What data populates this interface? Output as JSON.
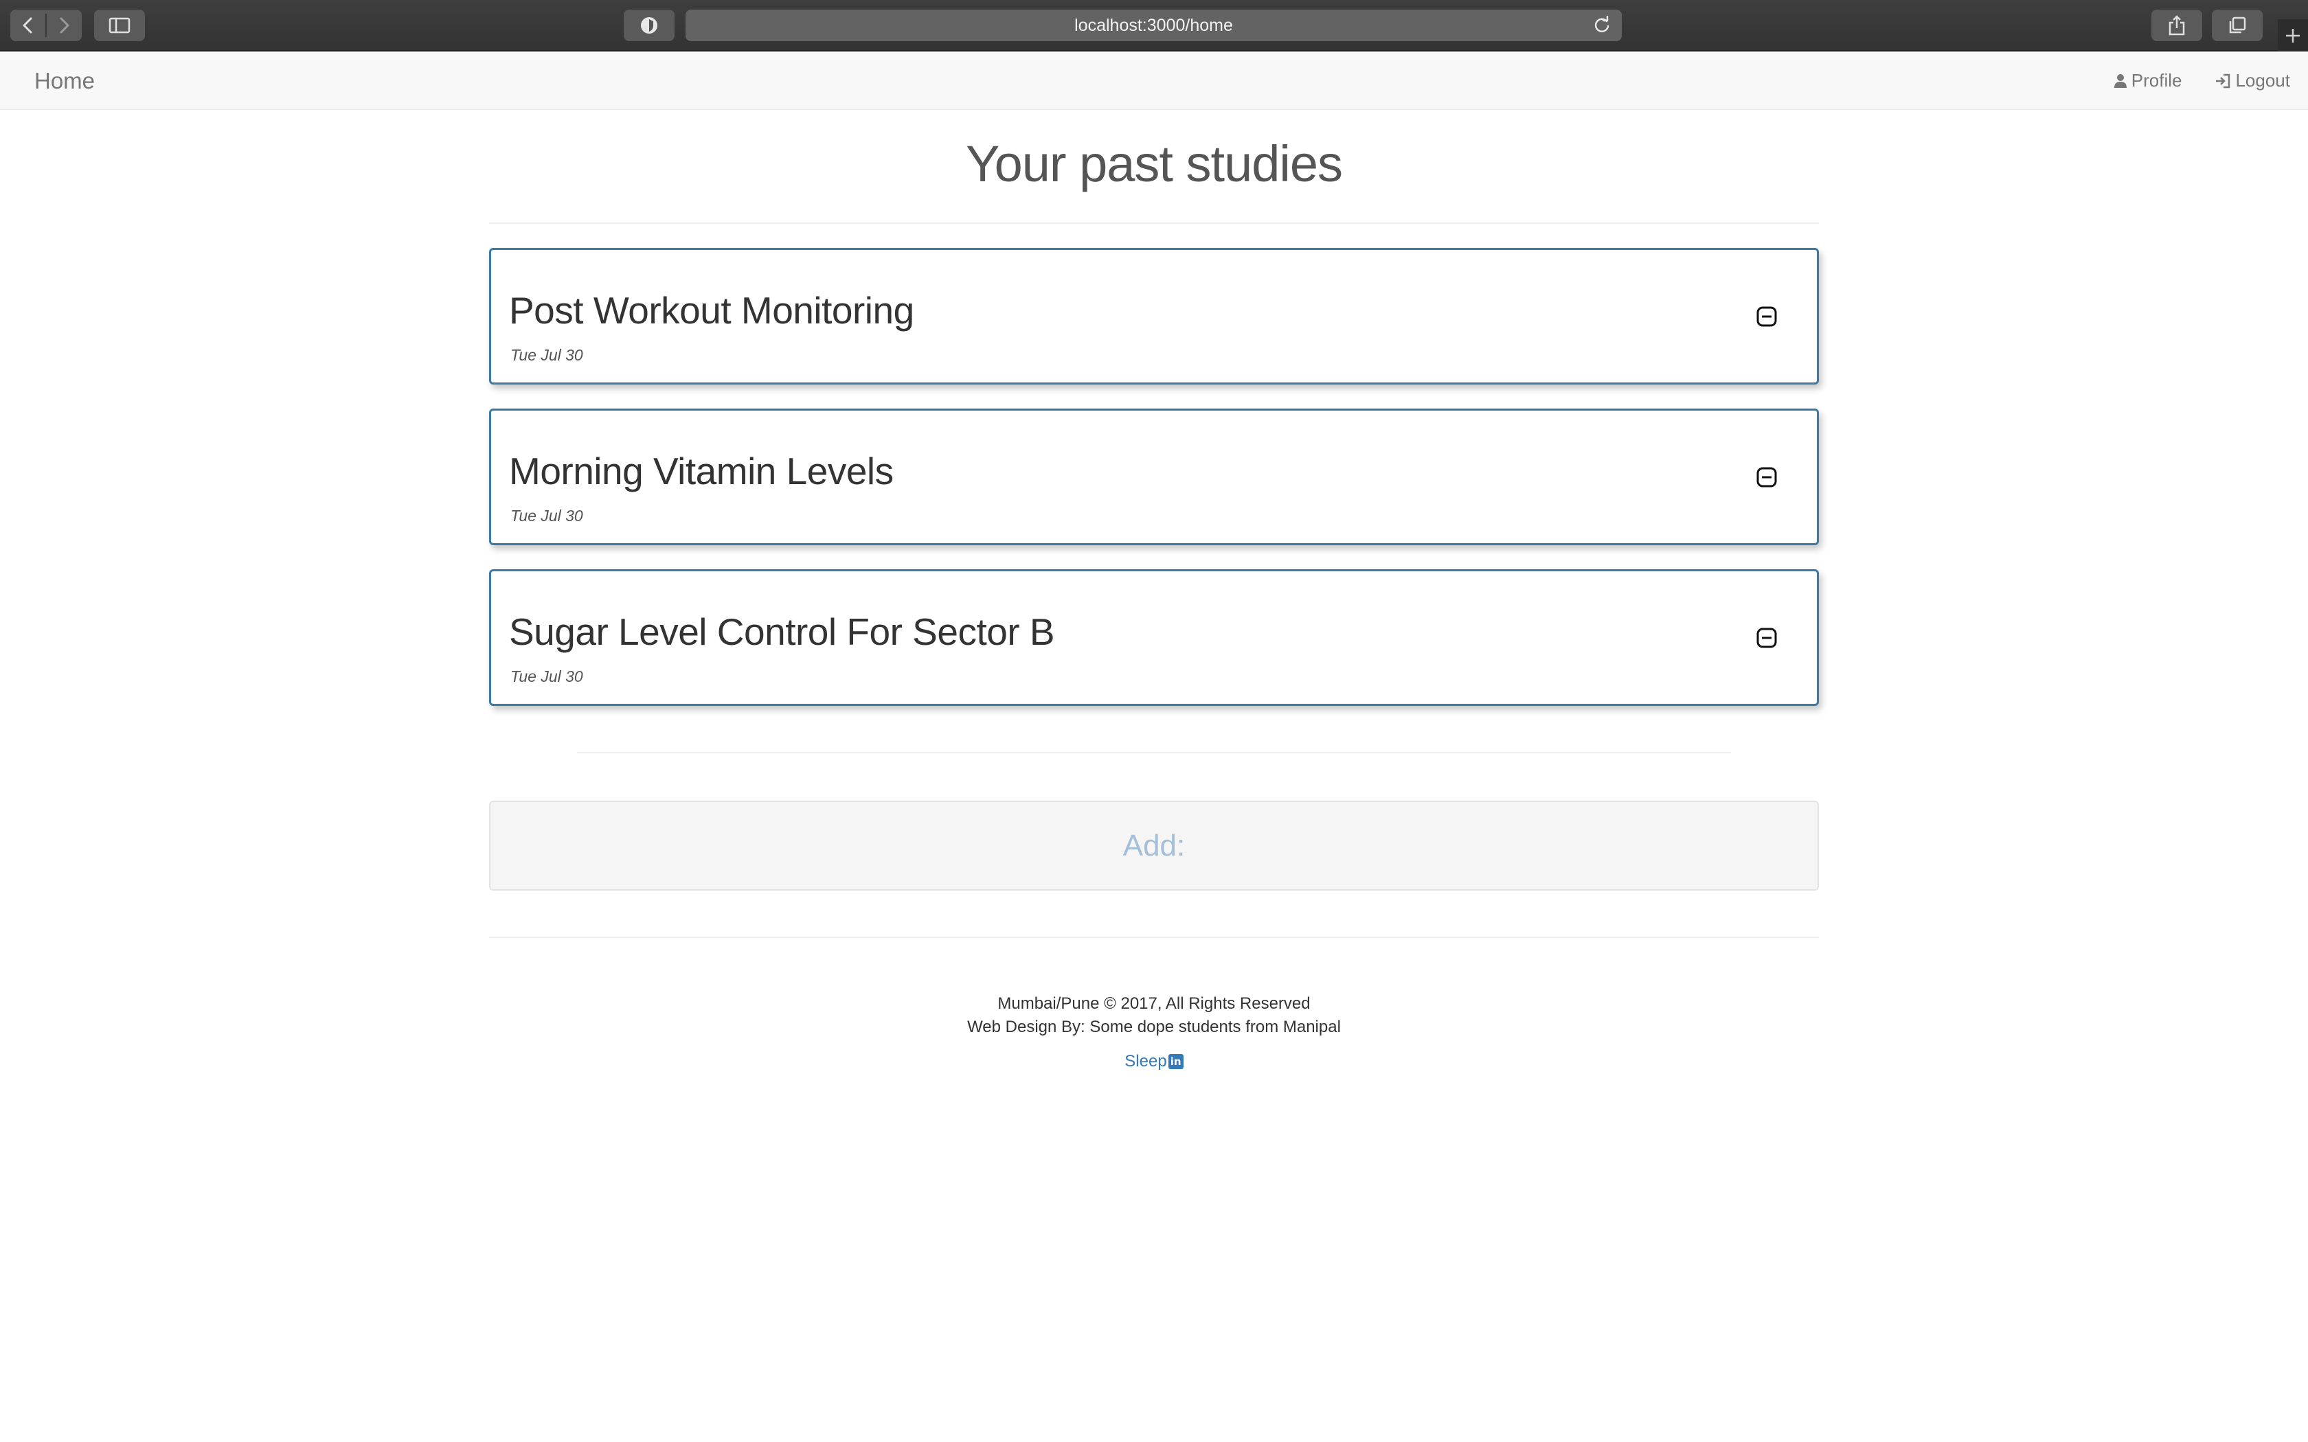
{
  "browser": {
    "url": "localhost:3000/home"
  },
  "navbar": {
    "brand": "Home",
    "profile_label": "Profile",
    "logout_label": "Logout"
  },
  "main": {
    "title": "Your past studies",
    "studies": [
      {
        "name": "Post Workout Monitoring",
        "date": "Tue Jul 30"
      },
      {
        "name": "Morning Vitamin Levels",
        "date": "Tue Jul 30"
      },
      {
        "name": "Sugar Level Control For Sector B",
        "date": "Tue Jul 30"
      }
    ],
    "add_label": "Add:"
  },
  "footer": {
    "copyright": "Mumbai/Pune © 2017, All Rights Reserved",
    "credit": "Web Design By: Some dope students from Manipal",
    "link_label": "Sleep",
    "link_icon": "linkedin-icon"
  },
  "colors": {
    "card_border": "#3c7aa6",
    "link": "#337ab7",
    "add_text": "#a4bfd8"
  }
}
